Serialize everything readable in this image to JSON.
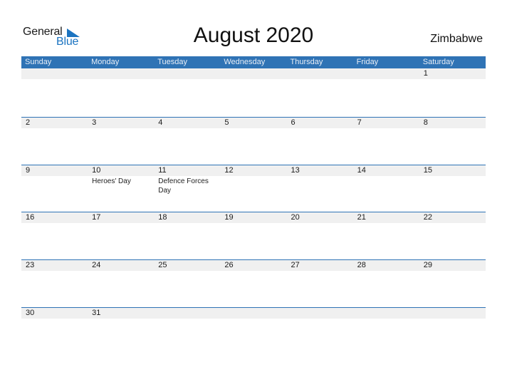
{
  "logo": {
    "word1": "General",
    "word2": "Blue",
    "brand_color": "#1c74c1"
  },
  "title": "August 2020",
  "country": "Zimbabwe",
  "header_color": "#2f73b5",
  "weekdays": [
    "Sunday",
    "Monday",
    "Tuesday",
    "Wednesday",
    "Thursday",
    "Friday",
    "Saturday"
  ],
  "weeks": [
    [
      {
        "d": ""
      },
      {
        "d": ""
      },
      {
        "d": ""
      },
      {
        "d": ""
      },
      {
        "d": ""
      },
      {
        "d": ""
      },
      {
        "d": "1"
      }
    ],
    [
      {
        "d": "2"
      },
      {
        "d": "3"
      },
      {
        "d": "4"
      },
      {
        "d": "5"
      },
      {
        "d": "6"
      },
      {
        "d": "7"
      },
      {
        "d": "8"
      }
    ],
    [
      {
        "d": "9"
      },
      {
        "d": "10",
        "h": "Heroes' Day"
      },
      {
        "d": "11",
        "h": "Defence Forces Day"
      },
      {
        "d": "12"
      },
      {
        "d": "13"
      },
      {
        "d": "14"
      },
      {
        "d": "15"
      }
    ],
    [
      {
        "d": "16"
      },
      {
        "d": "17"
      },
      {
        "d": "18"
      },
      {
        "d": "19"
      },
      {
        "d": "20"
      },
      {
        "d": "21"
      },
      {
        "d": "22"
      }
    ],
    [
      {
        "d": "23"
      },
      {
        "d": "24"
      },
      {
        "d": "25"
      },
      {
        "d": "26"
      },
      {
        "d": "27"
      },
      {
        "d": "28"
      },
      {
        "d": "29"
      }
    ],
    [
      {
        "d": "30"
      },
      {
        "d": "31"
      },
      {
        "d": ""
      },
      {
        "d": ""
      },
      {
        "d": ""
      },
      {
        "d": ""
      },
      {
        "d": ""
      }
    ]
  ]
}
